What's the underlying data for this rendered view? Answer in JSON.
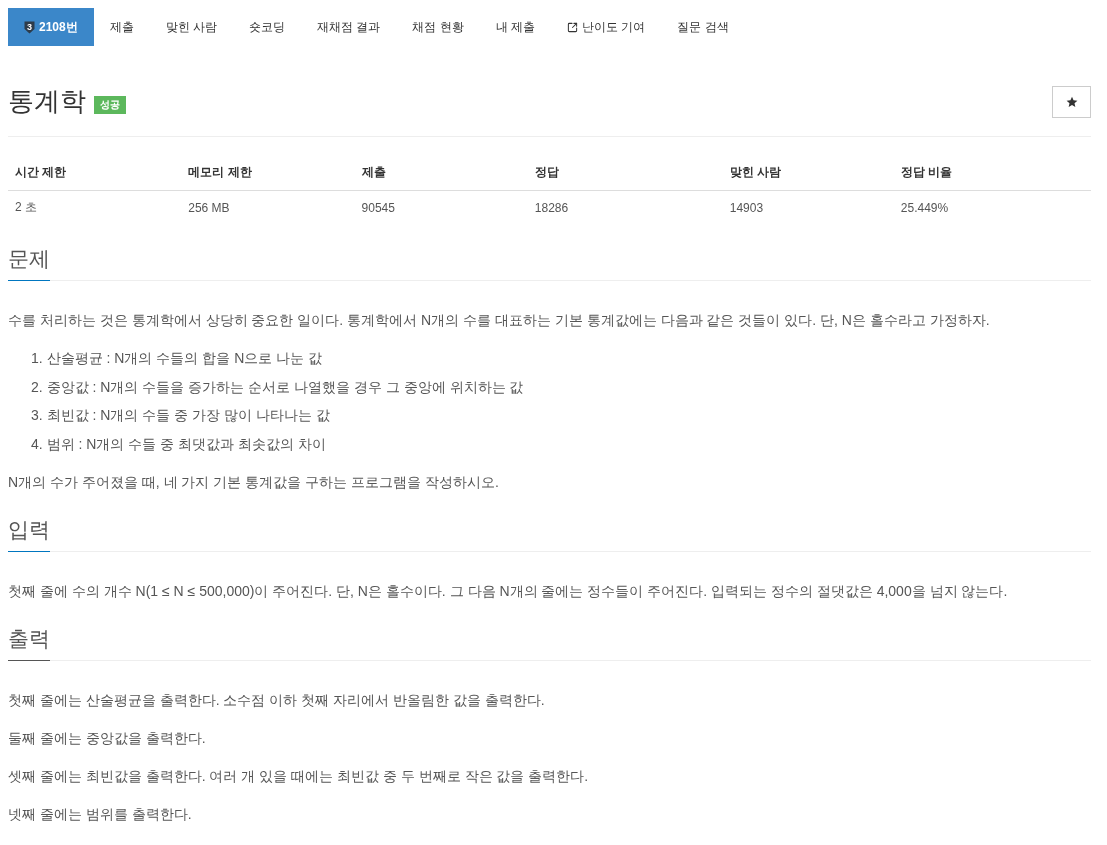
{
  "nav": {
    "tabs": [
      {
        "kind": "problem",
        "tier": "3",
        "label": "2108번",
        "selected": true
      },
      {
        "kind": "link",
        "label": "제출",
        "selected": false
      },
      {
        "kind": "link",
        "label": "맞힌 사람",
        "selected": false
      },
      {
        "kind": "link",
        "label": "숏코딩",
        "selected": false
      },
      {
        "kind": "link",
        "label": "재채점 결과",
        "selected": false
      },
      {
        "kind": "link",
        "label": "채점 현황",
        "selected": false
      },
      {
        "kind": "link",
        "label": "내 제출",
        "selected": false
      },
      {
        "kind": "external",
        "label": "난이도 기여",
        "selected": false
      },
      {
        "kind": "link",
        "label": "질문 검색",
        "selected": false
      }
    ]
  },
  "problem": {
    "title": "통계학",
    "status": {
      "kind": "success",
      "label": "성공"
    }
  },
  "stats": {
    "columns": [
      "시간 제한",
      "메모리 제한",
      "제출",
      "정답",
      "맞힌 사람",
      "정답 비율"
    ],
    "rows": [
      [
        "2 초",
        "256 MB",
        "90545",
        "18286",
        "14903",
        "25.449%"
      ]
    ]
  },
  "sections": [
    {
      "heading": "문제",
      "color": "#0076c0",
      "content": [
        {
          "kind": "paragraph",
          "text": "수를 처리하는 것은 통계학에서 상당히 중요한 일이다. 통계학에서 N개의 수를 대표하는 기본 통계값에는 다음과 같은 것들이 있다. 단, N은 홀수라고 가정하자."
        },
        {
          "kind": "list",
          "items": [
            {
              "number": "1.",
              "text": "산술평균 : N개의 수들의 합을 N으로 나눈 값"
            },
            {
              "number": "2.",
              "text": "중앙값 : N개의 수들을 증가하는 순서로 나열했을 경우 그 중앙에 위치하는 값"
            },
            {
              "number": "3.",
              "text": "최빈값 : N개의 수들 중 가장 많이 나타나는 값"
            },
            {
              "number": "4.",
              "text": "범위 : N개의 수들 중 최댓값과 최솟값의 차이"
            }
          ]
        },
        {
          "kind": "paragraph",
          "text": "N개의 수가 주어졌을 때, 네 가지 기본 통계값을 구하는 프로그램을 작성하시오."
        }
      ]
    },
    {
      "heading": "입력",
      "color": "#0076c0",
      "content": [
        {
          "kind": "paragraph",
          "text": "첫째 줄에 수의 개수 N(1 ≤ N ≤ 500,000)이 주어진다. 단, N은 홀수이다. 그 다음 N개의 줄에는 정수들이 주어진다. 입력되는 정수의 절댓값은 4,000을 넘지 않는다."
        }
      ]
    },
    {
      "heading": "출력",
      "color": "#555555",
      "content": [
        {
          "kind": "paragraph",
          "text": "첫째 줄에는 산술평균을 출력한다. 소수점 이하 첫째 자리에서 반올림한 값을 출력한다."
        },
        {
          "kind": "paragraph",
          "text": "둘째 줄에는 중앙값을 출력한다."
        },
        {
          "kind": "paragraph",
          "text": "셋째 줄에는 최빈값을 출력한다. 여러 개 있을 때에는 최빈값 중 두 번째로 작은 값을 출력한다."
        },
        {
          "kind": "paragraph",
          "text": "넷째 줄에는 범위를 출력한다."
        }
      ]
    }
  ]
}
